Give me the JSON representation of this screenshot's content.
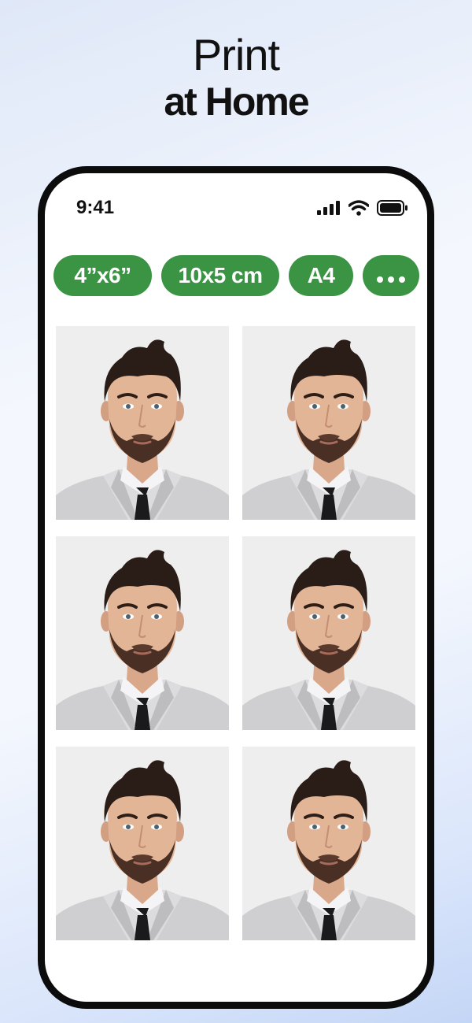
{
  "headline": {
    "line1": "Print",
    "line2": "at Home"
  },
  "status_bar": {
    "time": "9:41",
    "icons": [
      "signal-icon",
      "wifi-icon",
      "battery-icon"
    ]
  },
  "size_chips": [
    {
      "label": "4”x6”"
    },
    {
      "label": "10x5 cm"
    },
    {
      "label": "A4"
    },
    {
      "label": "",
      "icon": "more-icon"
    }
  ],
  "photos": {
    "count": 6,
    "subject": "passport-photo"
  },
  "colors": {
    "chip_green": "#3a9443",
    "photo_background": "#eeeeee",
    "phone_frame": "#0c0c0c"
  }
}
